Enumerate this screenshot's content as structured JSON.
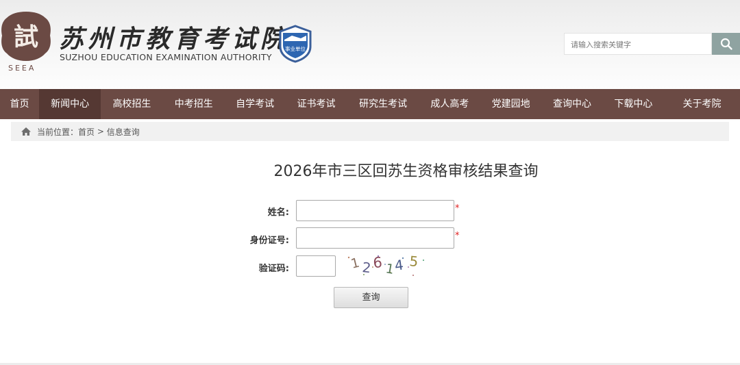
{
  "header": {
    "logo_seal_text": "試",
    "logo_abbr": "SEEA",
    "logo_cn": "苏州市教育考试院",
    "logo_en": "SUZHOU EDUCATION EXAMINATION AUTHORITY",
    "badge_text": "事业单位",
    "search_placeholder": "请输入搜索关键字",
    "search_icon": "search-icon"
  },
  "nav": {
    "items": [
      {
        "label": "首页"
      },
      {
        "label": "新闻中心"
      },
      {
        "label": "高校招生"
      },
      {
        "label": "中考招生"
      },
      {
        "label": "自学考试"
      },
      {
        "label": "证书考试"
      },
      {
        "label": "研究生考试"
      },
      {
        "label": "成人高考"
      },
      {
        "label": "党建园地"
      },
      {
        "label": "查询中心"
      },
      {
        "label": "下载中心"
      },
      {
        "label": "关于考院"
      }
    ],
    "active_index": 1
  },
  "breadcrumb": {
    "prefix": "当前位置：",
    "home": "首页",
    "separator": " > ",
    "current": "信息查询"
  },
  "page": {
    "title": "2026年市三区回苏生资格审核结果查询"
  },
  "form": {
    "name_label": "姓名:",
    "id_label": "身份证号:",
    "captcha_label": "验证码:",
    "required_mark": "*",
    "captcha_text": "126145",
    "submit_label": "查询"
  },
  "colors": {
    "nav_bg": "#6b4a44",
    "nav_active": "#553833",
    "search_btn": "#8fa3a1",
    "required": "#e02020"
  }
}
